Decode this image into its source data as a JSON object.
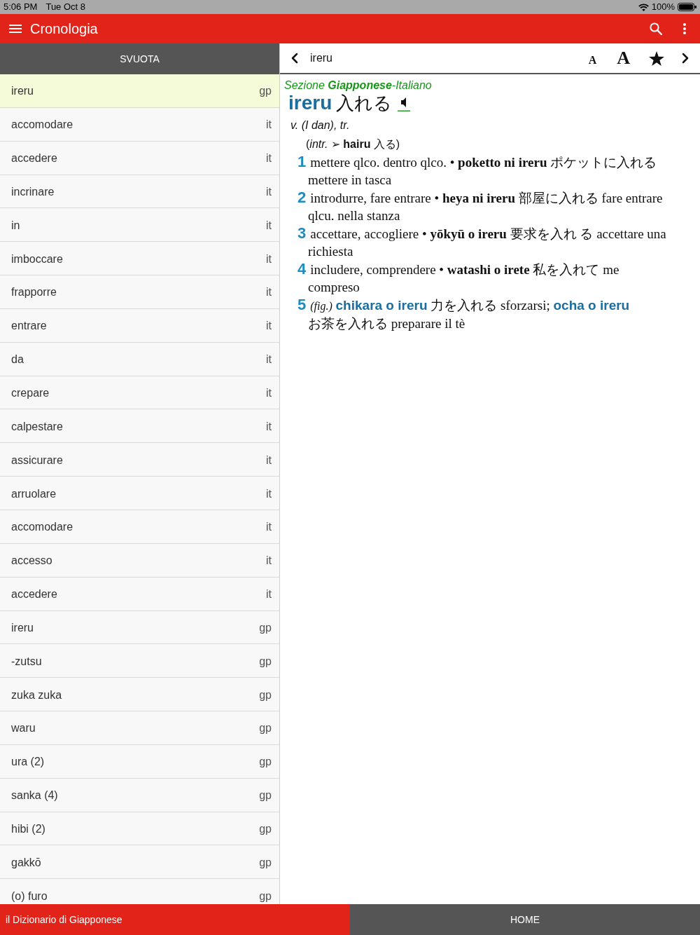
{
  "status_bar": {
    "time": "5:06 PM",
    "date": "Tue Oct 8",
    "battery": "100%"
  },
  "app_bar": {
    "title": "Cronologia"
  },
  "history": {
    "clear_button": "SVUOTA",
    "items": [
      {
        "word": "ireru",
        "lang": "gp",
        "selected": true
      },
      {
        "word": "accomodare",
        "lang": "it",
        "selected": false
      },
      {
        "word": "accedere",
        "lang": "it",
        "selected": false
      },
      {
        "word": "incrinare",
        "lang": "it",
        "selected": false
      },
      {
        "word": "in",
        "lang": "it",
        "selected": false
      },
      {
        "word": "imboccare",
        "lang": "it",
        "selected": false
      },
      {
        "word": "frapporre",
        "lang": "it",
        "selected": false
      },
      {
        "word": "entrare",
        "lang": "it",
        "selected": false
      },
      {
        "word": "da",
        "lang": "it",
        "selected": false
      },
      {
        "word": "crepare",
        "lang": "it",
        "selected": false
      },
      {
        "word": "calpestare",
        "lang": "it",
        "selected": false
      },
      {
        "word": "assicurare",
        "lang": "it",
        "selected": false
      },
      {
        "word": "arruolare",
        "lang": "it",
        "selected": false
      },
      {
        "word": "accomodare",
        "lang": "it",
        "selected": false
      },
      {
        "word": "accesso",
        "lang": "it",
        "selected": false
      },
      {
        "word": "accedere",
        "lang": "it",
        "selected": false
      },
      {
        "word": "ireru",
        "lang": "gp",
        "selected": false
      },
      {
        "word": "-zutsu",
        "lang": "gp",
        "selected": false
      },
      {
        "word": "zuka zuka",
        "lang": "gp",
        "selected": false
      },
      {
        "word": "waru",
        "lang": "gp",
        "selected": false
      },
      {
        "word": "ura (2)",
        "lang": "gp",
        "selected": false
      },
      {
        "word": "sanka (4)",
        "lang": "gp",
        "selected": false
      },
      {
        "word": "hibi (2)",
        "lang": "gp",
        "selected": false
      },
      {
        "word": "gakkō",
        "lang": "gp",
        "selected": false
      },
      {
        "word": "(o) furo",
        "lang": "gp",
        "selected": false
      }
    ]
  },
  "entry_toolbar": {
    "query": "ireru",
    "size_buttons": [
      {
        "label": "A",
        "kind": "smaller"
      },
      {
        "label": "A",
        "kind": "larger"
      }
    ]
  },
  "entry": {
    "section": "Sezione **Giapponese**-Italiano",
    "headword": "ireru",
    "kanji": "入れる",
    "grammar": "v. (I dan), tr.",
    "related": "(*intr.* ➢ **hairu** 入る)",
    "senses": [
      {
        "number": "1",
        "parts": [
          {
            "kind": "text",
            "text": "mettere qlco. dentro qlco. • **poketto ni ireru** ポケットに入れる mettere in tasca"
          }
        ]
      },
      {
        "number": "2",
        "parts": [
          {
            "kind": "text",
            "text": "introdurre, fare entrare • **heya ni ireru** 部屋に入れる fare entrare qlcu. nella stanza"
          }
        ]
      },
      {
        "number": "3",
        "parts": [
          {
            "kind": "text",
            "text": "accettare, accogliere • **yōkyū o ireru** 要求を入れ る accettare una richiesta"
          }
        ]
      },
      {
        "number": "4",
        "parts": [
          {
            "kind": "text",
            "text": "includere, comprendere • **watashi o irete** 私を入れて me compreso"
          }
        ]
      },
      {
        "number": "5",
        "parts": [
          {
            "kind": "label",
            "text": "(fig.)"
          },
          {
            "kind": "link",
            "text": "chikara o ireru"
          },
          {
            "kind": "text",
            "text": "力を入れる sforzarsi;"
          },
          {
            "kind": "link",
            "text": "ocha o ireru"
          },
          {
            "kind": "text",
            "text": "お茶を入れる preparare il tè"
          }
        ]
      }
    ]
  },
  "footer": {
    "title": "il Dizionario di Giapponese",
    "home_button": "HOME"
  }
}
